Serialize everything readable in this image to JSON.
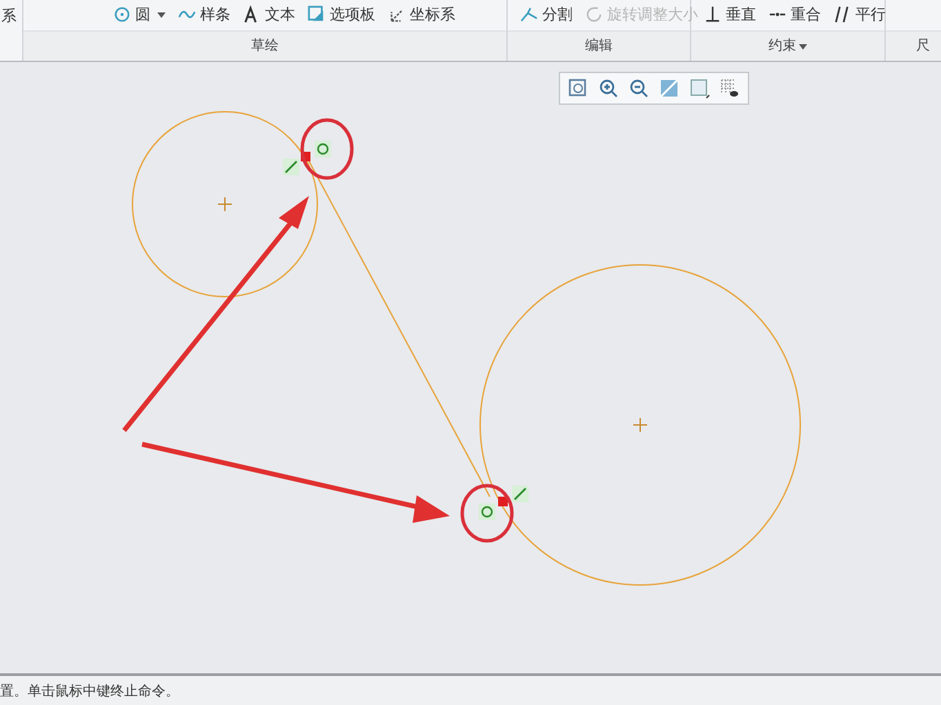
{
  "ribbon": {
    "left_cut_text": "系",
    "groups": [
      {
        "label": "草绘",
        "dropdown": false,
        "items": [
          {
            "label": "圆",
            "dropdown": true,
            "disabled": false
          },
          {
            "label": "样条",
            "dropdown": false,
            "disabled": false
          },
          {
            "label": "文本",
            "dropdown": false,
            "disabled": false
          },
          {
            "label": "选项板",
            "dropdown": false,
            "disabled": false
          },
          {
            "label": "坐标系",
            "dropdown": false,
            "disabled": false
          }
        ]
      },
      {
        "label": "编辑",
        "dropdown": false,
        "items": [
          {
            "label": "分割",
            "dropdown": false,
            "disabled": false
          },
          {
            "label": "旋转调整大小",
            "dropdown": false,
            "disabled": true
          }
        ]
      },
      {
        "label": "约束",
        "dropdown": true,
        "items": [
          {
            "label": "垂直",
            "dropdown": false,
            "disabled": false
          },
          {
            "label": "重合",
            "dropdown": false,
            "disabled": false
          },
          {
            "label": "平行",
            "dropdown": false,
            "disabled": false
          }
        ]
      }
    ],
    "right_cut_label": "尺"
  },
  "status_bar": {
    "message": "置。单击鼠标中键终止命令。"
  }
}
